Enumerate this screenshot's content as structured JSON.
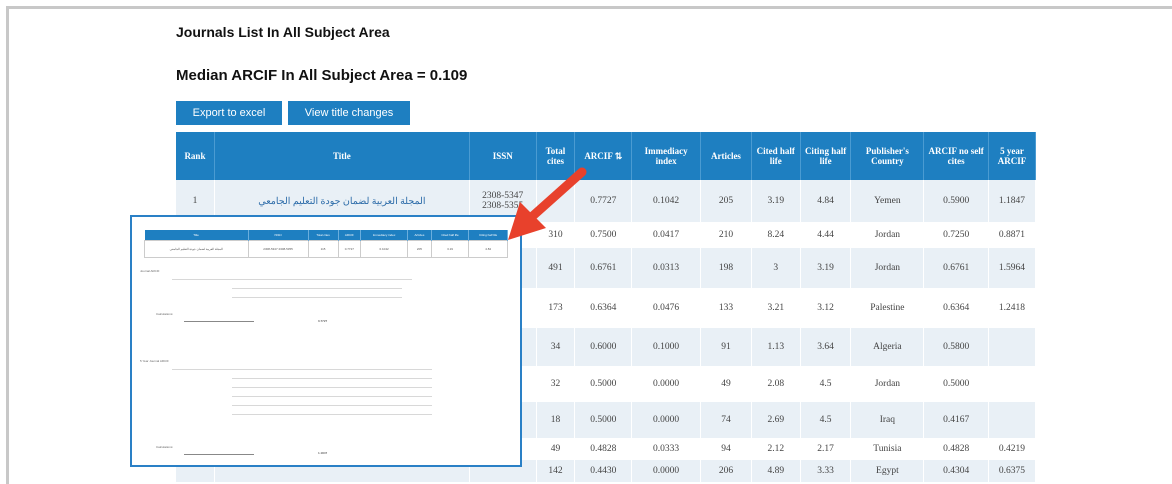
{
  "page": {
    "title": "Journals List In All Subject Area",
    "median": "Median ARCIF In All Subject Area = 0.109"
  },
  "toolbar": {
    "export_label": "Export to excel",
    "view_label": "View title changes"
  },
  "table": {
    "headers": [
      "Rank",
      "Title",
      "ISSN",
      "Total cites",
      "ARCIF",
      "Immediacy index",
      "Articles",
      "Cited half life",
      "Citing half life",
      "Publisher's Country",
      "ARCIF no self cites",
      "5 year ARCIF"
    ],
    "rows": [
      {
        "rank": "1",
        "title": "المجلة العربية لضمان جودة التعليم الجامعي",
        "issn": "2308-5347 2308-5355",
        "cites": "",
        "arcif": "0.7727",
        "imm": "0.1042",
        "articles": "205",
        "cited": "3.19",
        "citing": "4.84",
        "country": "Yemen",
        "noself": "0.5900",
        "five": "1.1847"
      },
      {
        "rank": "",
        "title": "",
        "issn": "",
        "cites": "310",
        "arcif": "0.7500",
        "imm": "0.0417",
        "articles": "210",
        "cited": "8.24",
        "citing": "4.44",
        "country": "Jordan",
        "noself": "0.7250",
        "five": "0.8871"
      },
      {
        "rank": "",
        "title": "",
        "issn": "",
        "cites": "491",
        "arcif": "0.6761",
        "imm": "0.0313",
        "articles": "198",
        "cited": "3",
        "citing": "3.19",
        "country": "Jordan",
        "noself": "0.6761",
        "five": "1.5964"
      },
      {
        "rank": "",
        "title": "",
        "issn": "",
        "cites": "173",
        "arcif": "0.6364",
        "imm": "0.0476",
        "articles": "133",
        "cited": "3.21",
        "citing": "3.12",
        "country": "Palestine",
        "noself": "0.6364",
        "five": "1.2418"
      },
      {
        "rank": "",
        "title": "",
        "issn": "",
        "cites": "34",
        "arcif": "0.6000",
        "imm": "0.1000",
        "articles": "91",
        "cited": "1.13",
        "citing": "3.64",
        "country": "Algeria",
        "noself": "0.5800",
        "five": ""
      },
      {
        "rank": "",
        "title": "",
        "issn": "",
        "cites": "32",
        "arcif": "0.5000",
        "imm": "0.0000",
        "articles": "49",
        "cited": "2.08",
        "citing": "4.5",
        "country": "Jordan",
        "noself": "0.5000",
        "five": ""
      },
      {
        "rank": "",
        "title": "",
        "issn": "",
        "cites": "18",
        "arcif": "0.5000",
        "imm": "0.0000",
        "articles": "74",
        "cited": "2.69",
        "citing": "4.5",
        "country": "Iraq",
        "noself": "0.4167",
        "five": ""
      },
      {
        "rank": "",
        "title": "",
        "issn": "",
        "cites": "49",
        "arcif": "0.4828",
        "imm": "0.0333",
        "articles": "94",
        "cited": "2.12",
        "citing": "2.17",
        "country": "Tunisia",
        "noself": "0.4828",
        "five": "0.4219"
      },
      {
        "rank": "",
        "title": "",
        "issn": "",
        "cites": "142",
        "arcif": "0.4430",
        "imm": "0.0000",
        "articles": "206",
        "cited": "4.89",
        "citing": "3.33",
        "country": "Egypt",
        "noself": "0.4304",
        "five": "0.6375"
      }
    ]
  },
  "inset": {
    "headers": [
      "Title",
      "ISSN",
      "Total cites",
      "ARCIF",
      "Immediacy index",
      "Articles",
      "Cited half life",
      "Citing half life"
    ],
    "row": [
      "المجلة العربية لضمان جودة التعليم الجامعي",
      "2308-5347 2308-5355",
      "115",
      "0.7727",
      "0.1042",
      "205",
      "3.19",
      "4.84"
    ],
    "section1": "Journal ARCIF",
    "section2": "5 Year Journal ARCIF",
    "calc_label": "Calculations:",
    "result1": "0.7727",
    "result2": "1.1847"
  },
  "colors": {
    "accent": "#1e7fc1",
    "arrow": "#e8412c",
    "inset_border": "#2a80c6"
  }
}
